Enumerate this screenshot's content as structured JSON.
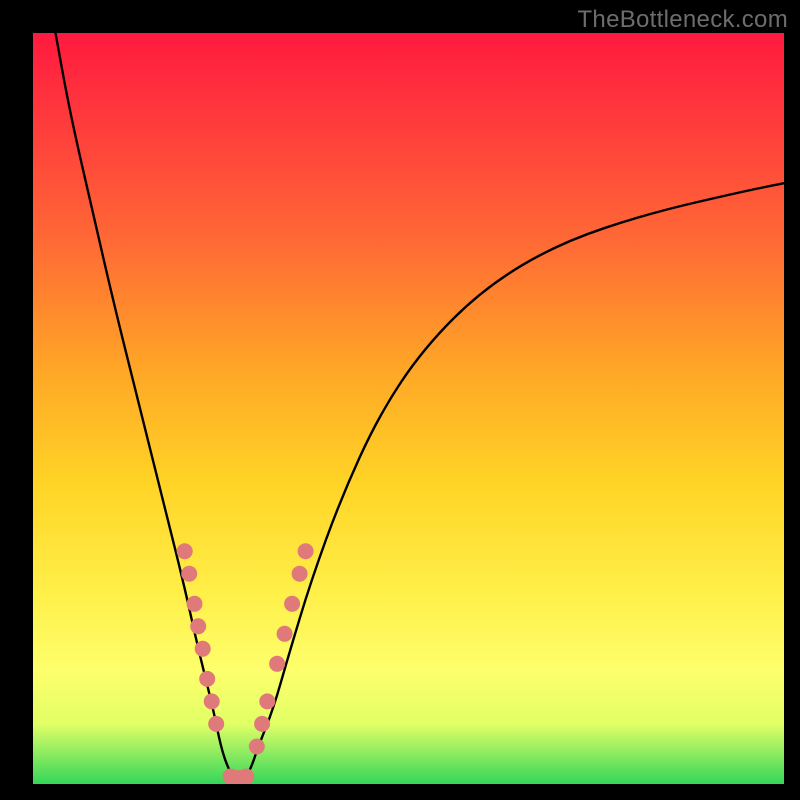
{
  "watermark": "TheBottleneck.com",
  "chart_data": {
    "type": "line",
    "title": "",
    "xlabel": "",
    "ylabel": "",
    "xlim": [
      0,
      100
    ],
    "ylim": [
      0,
      100
    ],
    "grid": false,
    "series": [
      {
        "name": "curve",
        "x": [
          3,
          5,
          8,
          11,
          14,
          17,
          20,
          22,
          24,
          25,
          26,
          27,
          28,
          29,
          30,
          32,
          34,
          37,
          41,
          46,
          52,
          60,
          70,
          82,
          95,
          100
        ],
        "y": [
          100,
          89,
          76,
          63,
          51,
          39,
          27,
          18,
          10,
          5,
          2,
          0.5,
          0.5,
          2,
          5,
          10,
          17,
          27,
          38,
          49,
          58,
          66,
          72,
          76,
          79,
          80
        ],
        "color": "#000000"
      }
    ],
    "markers": {
      "name": "highlight-dots",
      "color": "#e07a7a",
      "points": [
        {
          "x": 20.2,
          "y": 31
        },
        {
          "x": 20.8,
          "y": 28
        },
        {
          "x": 21.5,
          "y": 24
        },
        {
          "x": 22.0,
          "y": 21
        },
        {
          "x": 22.6,
          "y": 18
        },
        {
          "x": 23.2,
          "y": 14
        },
        {
          "x": 23.8,
          "y": 11
        },
        {
          "x": 24.4,
          "y": 8
        },
        {
          "x": 26.3,
          "y": 1
        },
        {
          "x": 27.0,
          "y": 0.8
        },
        {
          "x": 27.7,
          "y": 0.8
        },
        {
          "x": 28.4,
          "y": 1
        },
        {
          "x": 29.8,
          "y": 5
        },
        {
          "x": 30.5,
          "y": 8
        },
        {
          "x": 31.2,
          "y": 11
        },
        {
          "x": 32.5,
          "y": 16
        },
        {
          "x": 33.5,
          "y": 20
        },
        {
          "x": 34.5,
          "y": 24
        },
        {
          "x": 35.5,
          "y": 28
        },
        {
          "x": 36.3,
          "y": 31
        }
      ]
    }
  }
}
